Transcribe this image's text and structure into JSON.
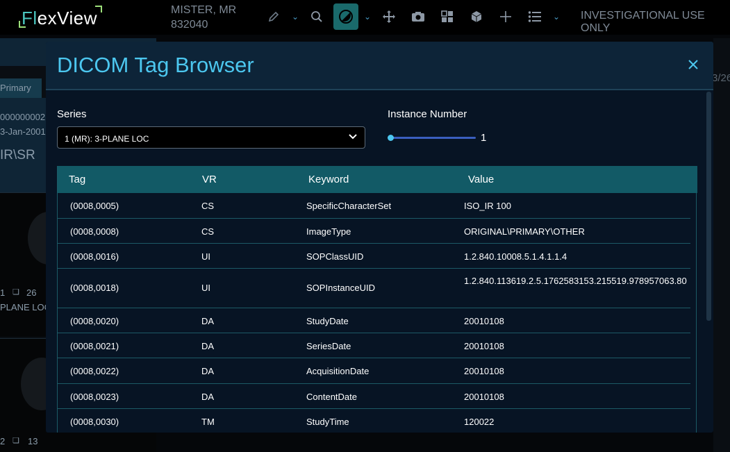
{
  "header": {
    "logo": {
      "prefix": "Fl",
      "suffix": "exView"
    },
    "patient_name": "MISTER, MR",
    "patient_id": "832040",
    "investigational": "INVESTIGATIONAL USE ONLY"
  },
  "left_panel": {
    "tab": "Primary",
    "info_line1": "000000002",
    "info_line2": "3-Jan-2001",
    "info_line3": "IR\\SR",
    "thumb1_count": "26",
    "thumb1_index": "1",
    "thumb1_label": "PLANE LOC",
    "thumb2_count": "13",
    "thumb2_index": "2"
  },
  "right_edge": {
    "partial_text": "3/26"
  },
  "dialog": {
    "title": "DICOM Tag Browser",
    "series_label": "Series",
    "series_value": "1 (MR): 3-PLANE LOC",
    "instance_label": "Instance Number",
    "instance_value": "1",
    "instance_fraction": 0.0,
    "columns": [
      "Tag",
      "VR",
      "Keyword",
      "Value"
    ],
    "rows": [
      {
        "tag": "(0008,0005)",
        "vr": "CS",
        "keyword": "SpecificCharacterSet",
        "value": "ISO_IR 100"
      },
      {
        "tag": "(0008,0008)",
        "vr": "CS",
        "keyword": "ImageType",
        "value": "ORIGINAL\\PRIMARY\\OTHER"
      },
      {
        "tag": "(0008,0016)",
        "vr": "UI",
        "keyword": "SOPClassUID",
        "value": "1.2.840.10008.5.1.4.1.1.4"
      },
      {
        "tag": "(0008,0018)",
        "vr": "UI",
        "keyword": "SOPInstanceUID",
        "value": "1.2.840.113619.2.5.1762583153.215519.978957063.80"
      },
      {
        "tag": "(0008,0020)",
        "vr": "DA",
        "keyword": "StudyDate",
        "value": "20010108"
      },
      {
        "tag": "(0008,0021)",
        "vr": "DA",
        "keyword": "SeriesDate",
        "value": "20010108"
      },
      {
        "tag": "(0008,0022)",
        "vr": "DA",
        "keyword": "AcquisitionDate",
        "value": "20010108"
      },
      {
        "tag": "(0008,0023)",
        "vr": "DA",
        "keyword": "ContentDate",
        "value": "20010108"
      },
      {
        "tag": "(0008,0030)",
        "vr": "TM",
        "keyword": "StudyTime",
        "value": "120022"
      }
    ]
  },
  "colors": {
    "accent": "#4cc7ef",
    "header_row": "#125a66",
    "modal_bg": "#071424",
    "active_tool": "#1a6a6b"
  }
}
